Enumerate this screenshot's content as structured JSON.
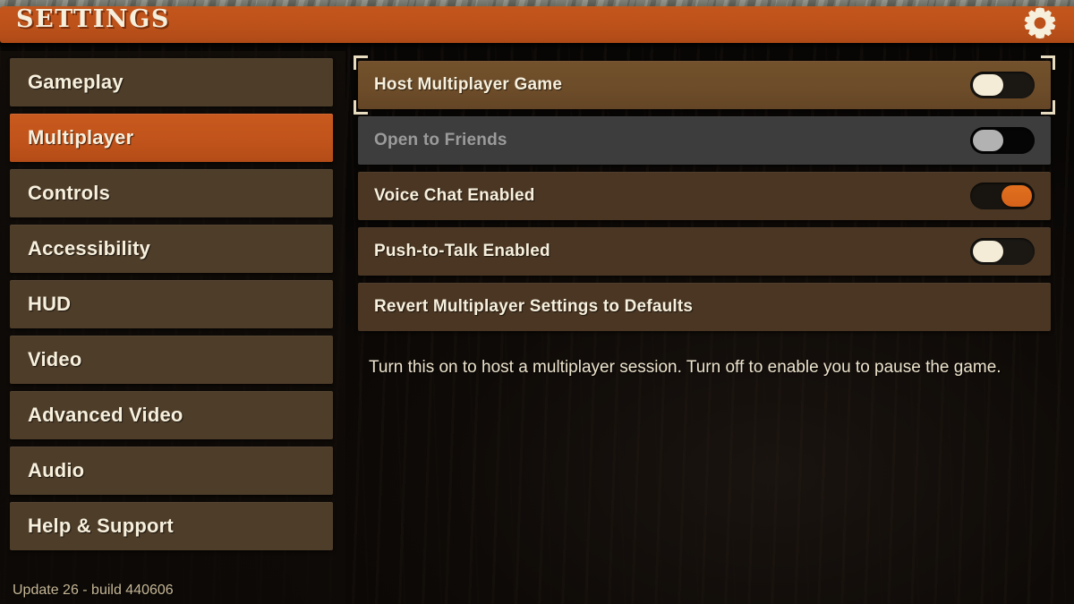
{
  "header": {
    "title": "SETTINGS",
    "gear_icon": "gear-icon"
  },
  "sidebar": {
    "items": [
      {
        "label": "Gameplay",
        "selected": false
      },
      {
        "label": "Multiplayer",
        "selected": true
      },
      {
        "label": "Controls",
        "selected": false
      },
      {
        "label": "Accessibility",
        "selected": false
      },
      {
        "label": "HUD",
        "selected": false
      },
      {
        "label": "Video",
        "selected": false
      },
      {
        "label": "Advanced Video",
        "selected": false
      },
      {
        "label": "Audio",
        "selected": false
      },
      {
        "label": "Help & Support",
        "selected": false
      }
    ],
    "version": "Update 26 - build 440606"
  },
  "main": {
    "options": [
      {
        "label": "Host Multiplayer Game",
        "type": "toggle",
        "value": "off",
        "focused": true,
        "disabled": false
      },
      {
        "label": "Open to Friends",
        "type": "toggle",
        "value": "off",
        "focused": false,
        "disabled": true
      },
      {
        "label": "Voice Chat Enabled",
        "type": "toggle",
        "value": "on",
        "focused": false,
        "disabled": false
      },
      {
        "label": "Push-to-Talk Enabled",
        "type": "toggle",
        "value": "off",
        "focused": false,
        "disabled": false
      },
      {
        "label": "Revert Multiplayer Settings to Defaults",
        "type": "action",
        "value": "",
        "focused": false,
        "disabled": false
      }
    ],
    "description": "Turn this on to host a multiplayer session. Turn off to enable you to pause the game."
  },
  "colors": {
    "accent_orange": "#c0531b",
    "row_brown": "#4a3623",
    "row_brown_focused": "#6c4c29",
    "row_disabled": "#3d3d3d",
    "text_cream": "#f7f0dd",
    "text_disabled": "#9b9b9b",
    "toggle_on": "#d4621a",
    "toggle_knob_off": "#f4ecd6",
    "toggle_knob_disabled": "#b2b2b2"
  }
}
